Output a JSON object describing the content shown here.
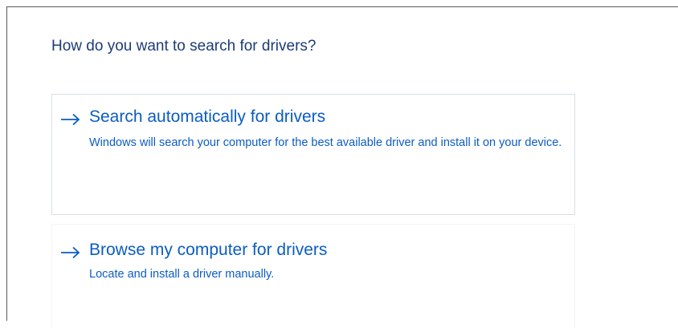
{
  "dialog": {
    "heading": "How do you want to search for drivers?",
    "accent_color": "#0b5cc5",
    "heading_color": "#1c3b78",
    "options": [
      {
        "icon": "arrow-right-icon",
        "title": "Search automatically for drivers",
        "description": "Windows will search your computer for the best available driver and install it on your device."
      },
      {
        "icon": "arrow-right-icon",
        "title": "Browse my computer for drivers",
        "description": "Locate and install a driver manually."
      }
    ]
  }
}
